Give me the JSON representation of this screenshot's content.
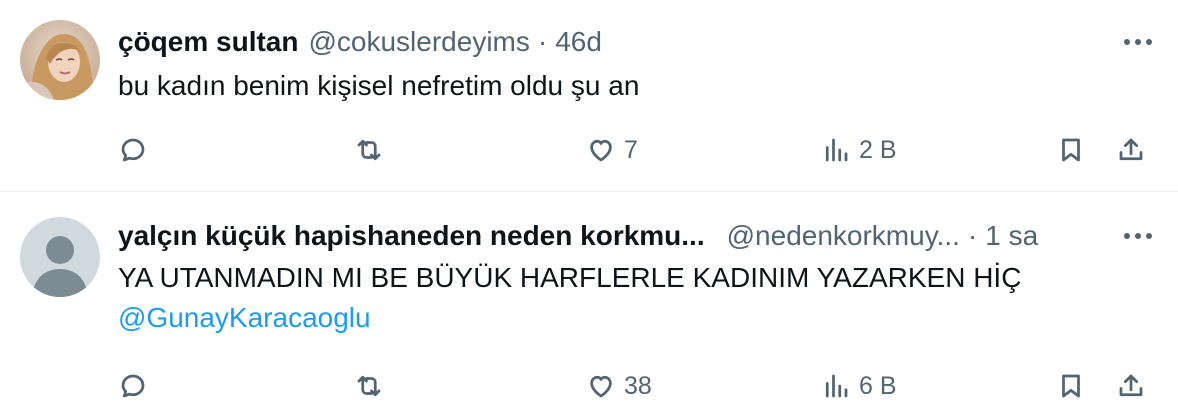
{
  "tweets": [
    {
      "display_name": "çöqem sultan",
      "handle": "@cokuslerdeyims",
      "separator": "·",
      "time": "46d",
      "text": "bu kadın benim kişisel nefretim oldu şu an",
      "mention": "",
      "avatar": "photo-avatar",
      "actions": {
        "replies": "",
        "retweets": "",
        "likes": "7",
        "views": "2 B"
      }
    },
    {
      "display_name": "yalçın küçük hapishaneden neden korkmu...",
      "handle": "@nedenkorkmuy...",
      "separator": "·",
      "time": "1 sa",
      "text": "YA UTANMADIN MI BE BÜYÜK HARFLERLE KADINIM YAZARKEN HİÇ",
      "mention": "@GunayKaracaoglu",
      "avatar": "default-avatar",
      "actions": {
        "replies": "",
        "retweets": "",
        "likes": "38",
        "views": "6 B"
      }
    }
  ],
  "colors": {
    "text_primary": "#0f1419",
    "text_secondary": "#536471",
    "link": "#1d9bf0",
    "divider": "#eff3f4"
  },
  "icons": [
    "reply-icon",
    "retweet-icon",
    "like-icon",
    "views-icon",
    "bookmark-icon",
    "share-icon",
    "more-icon"
  ]
}
